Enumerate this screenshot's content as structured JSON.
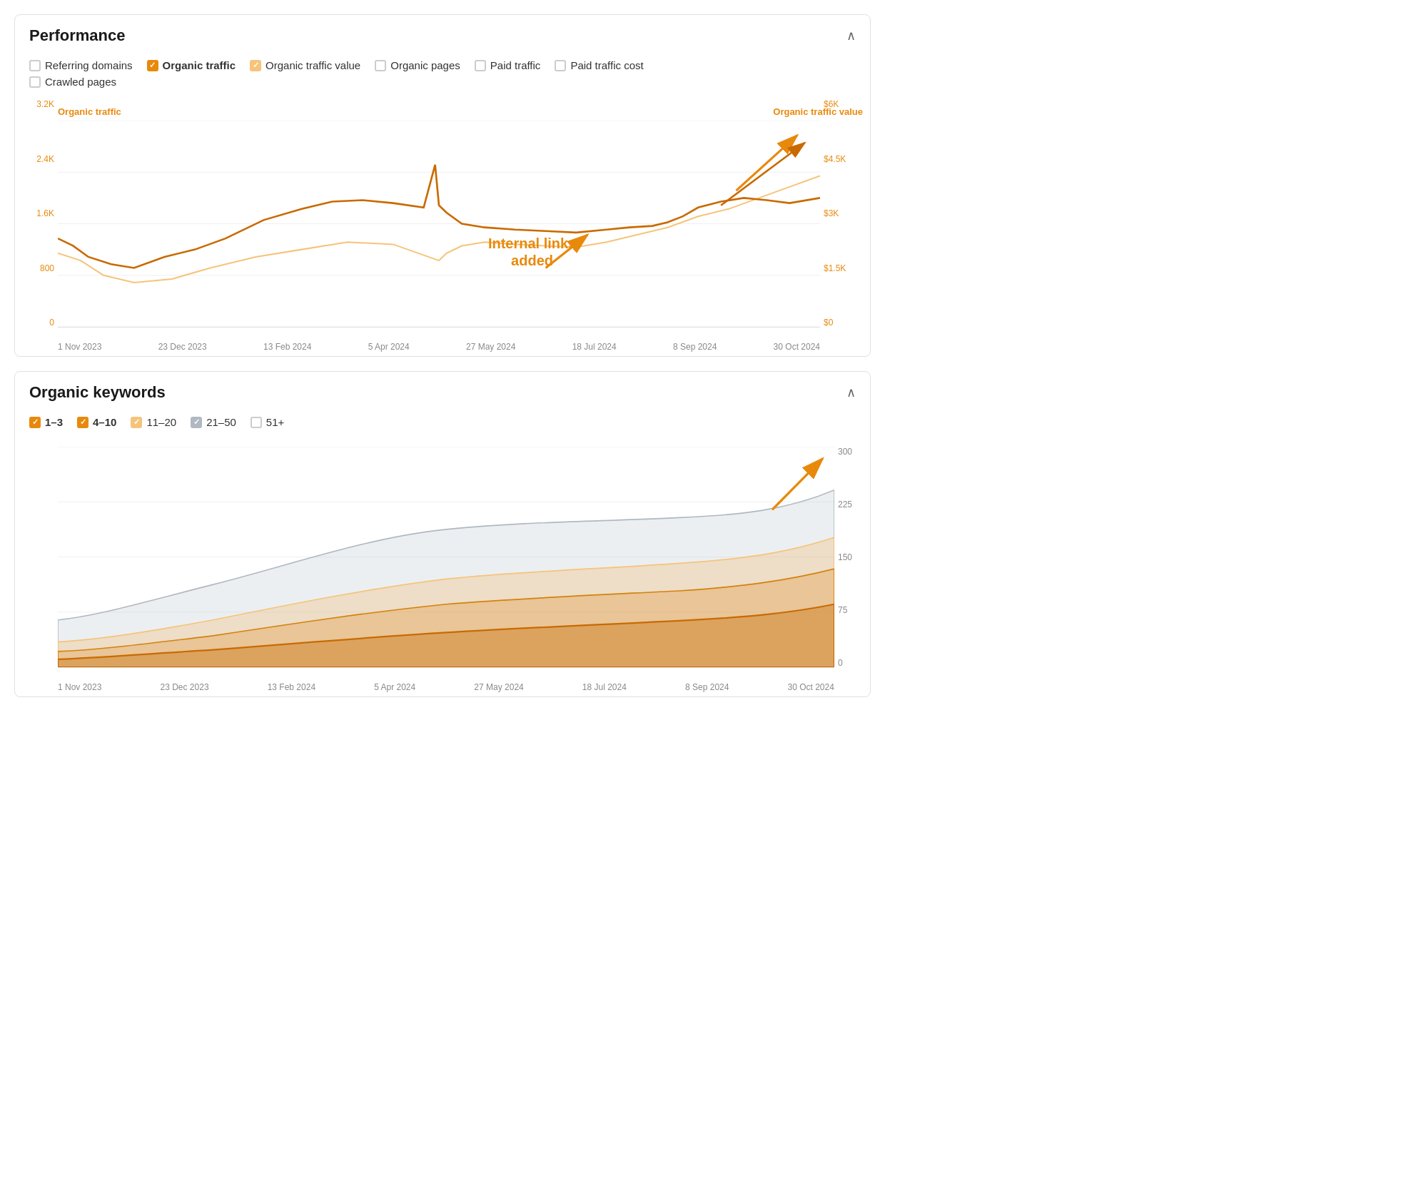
{
  "performance": {
    "title": "Performance",
    "filters": [
      {
        "id": "referring-domains",
        "label": "Referring domains",
        "checked": false,
        "checkStyle": "unchecked"
      },
      {
        "id": "organic-traffic",
        "label": "Organic traffic",
        "checked": true,
        "checkStyle": "checked-orange"
      },
      {
        "id": "organic-traffic-value",
        "label": "Organic traffic value",
        "checked": true,
        "checkStyle": "checked-light-orange"
      },
      {
        "id": "organic-pages",
        "label": "Organic pages",
        "checked": false,
        "checkStyle": "unchecked"
      },
      {
        "id": "paid-traffic",
        "label": "Paid traffic",
        "checked": false,
        "checkStyle": "unchecked"
      },
      {
        "id": "paid-traffic-cost",
        "label": "Paid traffic cost",
        "checked": false,
        "checkStyle": "unchecked"
      },
      {
        "id": "crawled-pages",
        "label": "Crawled pages",
        "checked": false,
        "checkStyle": "unchecked"
      }
    ],
    "axisLeft": "Organic traffic",
    "axisRight": "Organic traffic value",
    "leftLabels": [
      "3.2K",
      "2.4K",
      "1.6K",
      "800",
      "0"
    ],
    "rightLabels": [
      "$6K",
      "$4.5K",
      "$3K",
      "$1.5K",
      "$0"
    ],
    "xLabels": [
      "1 Nov 2023",
      "23 Dec 2023",
      "13 Feb 2024",
      "5 Apr 2024",
      "27 May 2024",
      "18 Jul 2024",
      "8 Sep 2024",
      "30 Oct 2024"
    ],
    "annotation": "Internal links\nadded"
  },
  "organicKeywords": {
    "title": "Organic keywords",
    "filters": [
      {
        "id": "kw-1-3",
        "label": "1–3",
        "checkStyle": "checked-orange"
      },
      {
        "id": "kw-4-10",
        "label": "4–10",
        "checkStyle": "checked-orange"
      },
      {
        "id": "kw-11-20",
        "label": "11–20",
        "checkStyle": "checked-light-orange"
      },
      {
        "id": "kw-21-50",
        "label": "21–50",
        "checkStyle": "checked-gray"
      },
      {
        "id": "kw-51plus",
        "label": "51+",
        "checkStyle": "unchecked"
      }
    ],
    "rightLabels": [
      "300",
      "225",
      "150",
      "75",
      "0"
    ],
    "xLabels": [
      "1 Nov 2023",
      "23 Dec 2023",
      "13 Feb 2024",
      "5 Apr 2024",
      "27 May 2024",
      "18 Jul 2024",
      "8 Sep 2024",
      "30 Oct 2024"
    ]
  }
}
